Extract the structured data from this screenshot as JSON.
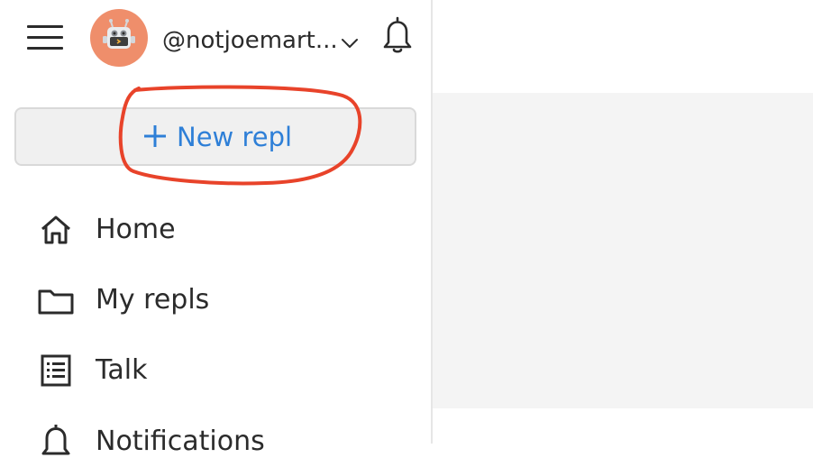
{
  "header": {
    "username": "@notjoemart...",
    "menu_icon": "hamburger-menu-icon",
    "avatar_icon": "robot-avatar",
    "dropdown_icon": "chevron-down-icon",
    "bell_icon": "bell-icon"
  },
  "new_repl": {
    "label": "New repl",
    "icon": "plus-icon",
    "accent_color": "#2e7fd7",
    "annotation_color": "#e8432a"
  },
  "nav": {
    "items": [
      {
        "label": "Home",
        "icon": "home-icon"
      },
      {
        "label": "My repls",
        "icon": "folder-icon"
      },
      {
        "label": "Talk",
        "icon": "list-icon"
      },
      {
        "label": "Notifications",
        "icon": "bell-icon"
      }
    ]
  }
}
